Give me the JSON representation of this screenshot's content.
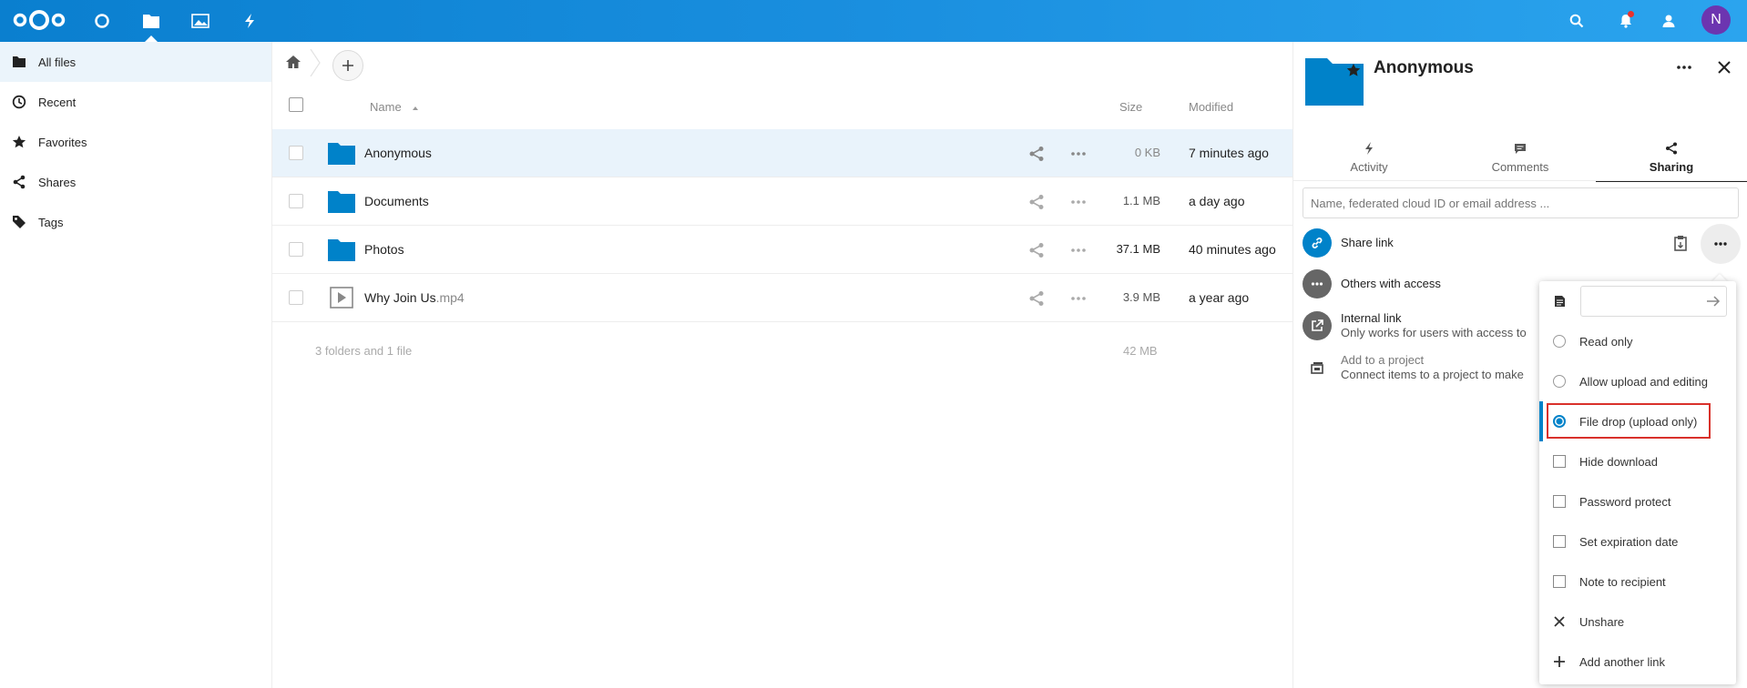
{
  "header": {
    "apps": [
      {
        "name": "dashboard",
        "icon": "dashboard-circle-icon"
      },
      {
        "name": "files",
        "icon": "folder-icon",
        "active": true
      },
      {
        "name": "photos",
        "icon": "image-icon"
      },
      {
        "name": "activity",
        "icon": "lightning-icon"
      }
    ],
    "avatar_letter": "N"
  },
  "sidebar": {
    "items": [
      {
        "label": "All files",
        "icon": "folder-icon",
        "active": true
      },
      {
        "label": "Recent",
        "icon": "clock-icon"
      },
      {
        "label": "Favorites",
        "icon": "star-icon"
      },
      {
        "label": "Shares",
        "icon": "share-icon"
      },
      {
        "label": "Tags",
        "icon": "tag-icon"
      }
    ]
  },
  "files": {
    "columns": {
      "name": "Name",
      "size": "Size",
      "modified": "Modified"
    },
    "rows": [
      {
        "name": "Anonymous",
        "ext": "",
        "size": "0 KB",
        "modified": "7 minutes ago",
        "type": "folder"
      },
      {
        "name": "Documents",
        "ext": "",
        "size": "1.1 MB",
        "modified": "a day ago",
        "type": "folder"
      },
      {
        "name": "Photos",
        "ext": "",
        "size": "37.1 MB",
        "modified": "40 minutes ago",
        "type": "folder"
      },
      {
        "name": "Why Join Us",
        "ext": ".mp4",
        "size": "3.9 MB",
        "modified": "a year ago",
        "type": "video"
      }
    ],
    "summary": "3 folders and 1 file",
    "summary_size": "42 MB"
  },
  "panel": {
    "title": "Anonymous",
    "tabs": [
      "Activity",
      "Comments",
      "Sharing"
    ],
    "share_placeholder": "Name, federated cloud ID or email address ...",
    "share_link": "Share link",
    "others_access": "Others with access",
    "internal_link": "Internal link",
    "internal_link_sub": "Only works for users with access to",
    "add_project": "Add to a project",
    "add_project_sub": "Connect items to a project to make"
  },
  "menu": {
    "items": [
      "Read only",
      "Allow upload and editing",
      "File drop (upload only)",
      "Hide download",
      "Password protect",
      "Set expiration date",
      "Note to recipient",
      "Unshare",
      "Add another link"
    ],
    "selected": "File drop (upload only)"
  },
  "colors": {
    "header": "#0082c9",
    "accent": "#0082c9",
    "highlight": "#d9312b"
  }
}
